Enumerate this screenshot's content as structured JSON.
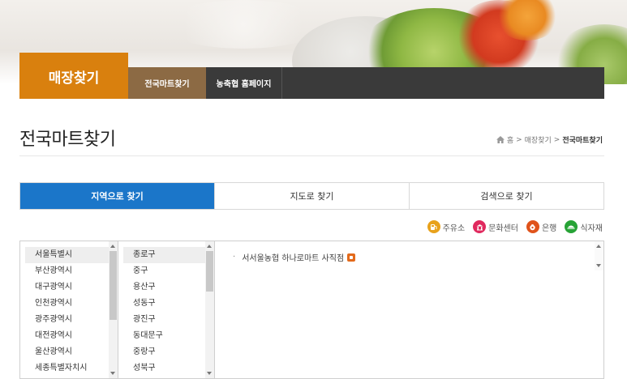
{
  "nav": {
    "title": "매장찾기",
    "tabs": [
      "전국마트찾기",
      "농축협 홈페이지"
    ]
  },
  "page": {
    "title": "전국마트찾기"
  },
  "breadcrumb": {
    "home": "홈",
    "separator": ">",
    "section": "매장찾기",
    "current": "전국마트찾기"
  },
  "search_tabs": [
    {
      "label": "지역으로 찾기",
      "active": true
    },
    {
      "label": "지도로 찾기",
      "active": false
    },
    {
      "label": "검색으로 찾기",
      "active": false
    }
  ],
  "legend": [
    {
      "label": "주유소",
      "icon": "gas-station-icon",
      "color": "#e8a21c"
    },
    {
      "label": "문화센터",
      "icon": "culture-center-icon",
      "color": "#e0295e"
    },
    {
      "label": "은행",
      "icon": "bank-icon",
      "color": "#e0531b"
    },
    {
      "label": "식자재",
      "icon": "food-ingredients-icon",
      "color": "#27a336"
    }
  ],
  "regions": [
    "서울특별시",
    "부산광역시",
    "대구광역시",
    "인천광역시",
    "광주광역시",
    "대전광역시",
    "울산광역시",
    "세종특별자치시"
  ],
  "selected_region": "서울특별시",
  "districts": [
    "종로구",
    "중구",
    "용산구",
    "성동구",
    "광진구",
    "동대문구",
    "중랑구",
    "성북구"
  ],
  "selected_district": "종로구",
  "stores": [
    {
      "name": "서서울농협 하나로마트 사직점",
      "badge": "store-icon",
      "badge_color": "#e36a1b"
    }
  ],
  "colors": {
    "brand_orange": "#d9800e",
    "nav_dark": "#3a3a3a",
    "nav_active": "#8c6a44",
    "active_blue": "#1b76c9"
  }
}
